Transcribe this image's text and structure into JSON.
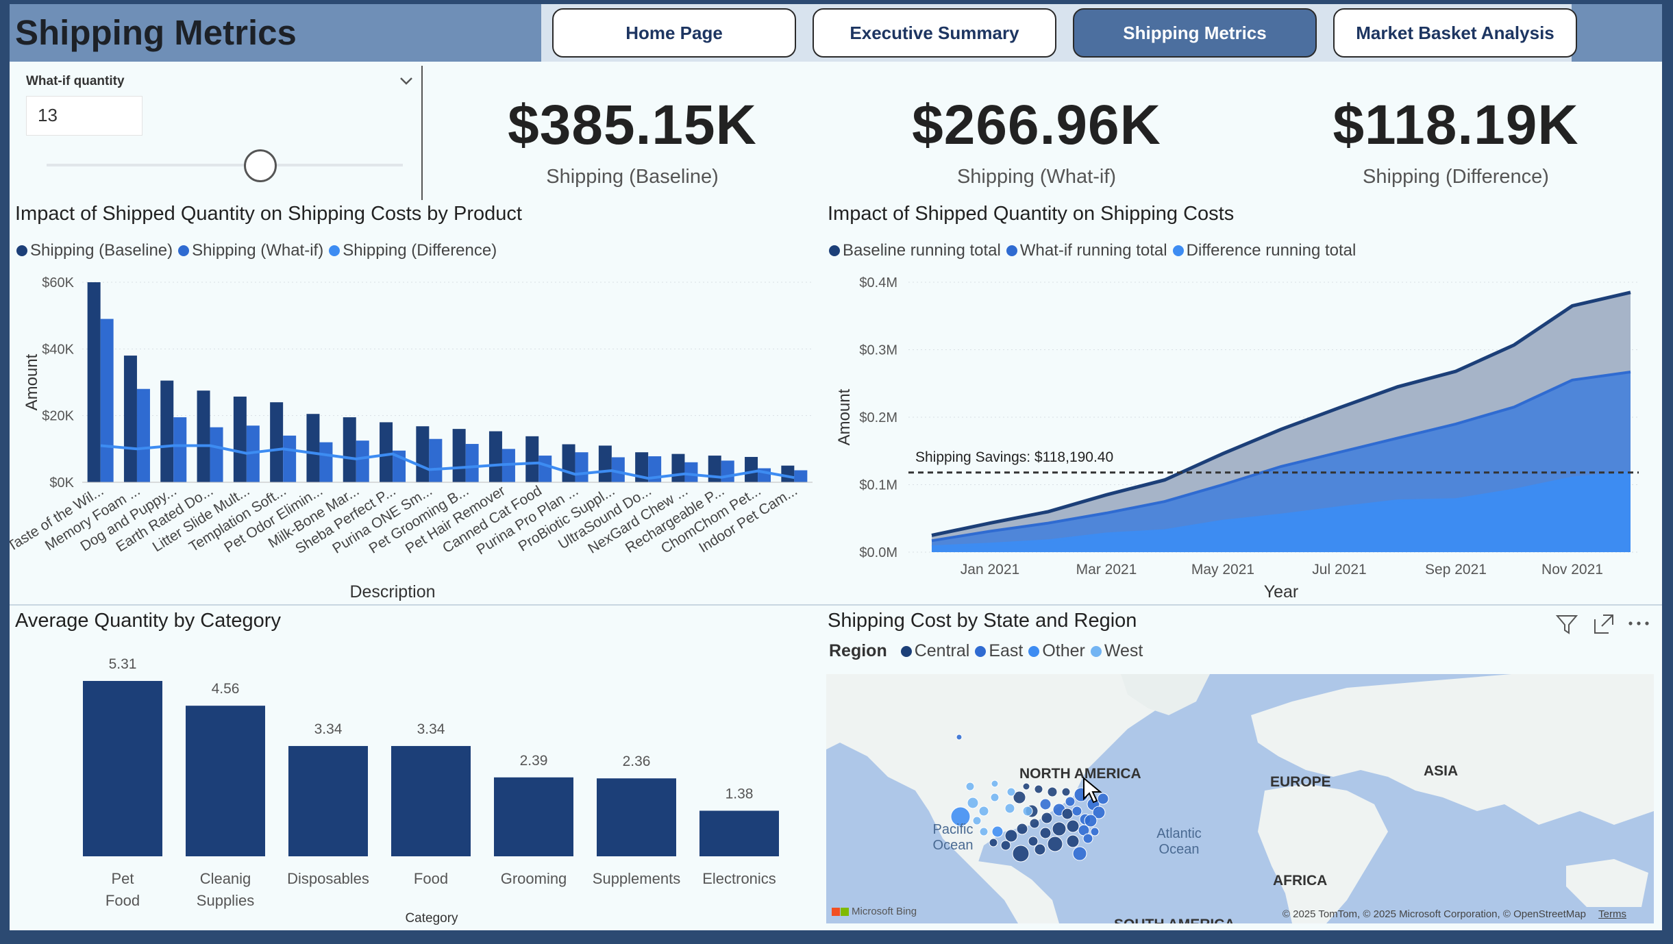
{
  "page": {
    "title": "Shipping Metrics"
  },
  "nav": [
    {
      "label": "Home Page",
      "active": false
    },
    {
      "label": "Executive Summary",
      "active": false
    },
    {
      "label": "Shipping Metrics",
      "active": true
    },
    {
      "label": "Market Basket Analysis",
      "active": false
    }
  ],
  "slicer": {
    "label": "What-if quantity",
    "value": "13",
    "chevron_icon": "chevron-down-icon",
    "slider_fraction": 0.6
  },
  "kpis": [
    {
      "value": "$385.15K",
      "label": "Shipping (Baseline)"
    },
    {
      "value": "$266.96K",
      "label": "Shipping (What-if)"
    },
    {
      "value": "$118.19K",
      "label": "Shipping (Difference)"
    }
  ],
  "colors": {
    "dark": "#1c3f78",
    "mid": "#2f6bd1",
    "light": "#3d8cf2",
    "lighter": "#72b4f3"
  },
  "product_chart": {
    "title": "Impact of Shipped Quantity on Shipping Costs by Product",
    "legend": [
      "Shipping (Baseline)",
      "Shipping (What-if)",
      "Shipping (Difference)"
    ]
  },
  "timeline_chart": {
    "title": "Impact of Shipped Quantity on Shipping Costs",
    "legend": [
      "Baseline running total",
      "What-if running total",
      "Difference running total"
    ],
    "annotation": "Shipping Savings: $118,190.40"
  },
  "category_chart": {
    "title": "Average Quantity by Category"
  },
  "map_visual": {
    "title": "Shipping Cost by State and Region",
    "legend_title": "Region",
    "regions": [
      "Central",
      "East",
      "Other",
      "West"
    ],
    "labels": [
      "NORTH AMERICA",
      "EUROPE",
      "ASIA",
      "AFRICA",
      "SOUTH AMERICA",
      "Pacific Ocean",
      "Atlantic Ocean"
    ],
    "attribution": "© 2025 TomTom, © 2025 Microsoft Corporation, © OpenStreetMap",
    "terms": "Terms",
    "brand": "Microsoft Bing",
    "header_icons": [
      "filter-icon",
      "focus-mode-icon",
      "more-options-icon"
    ]
  },
  "chart_data": [
    {
      "type": "bar",
      "title": "Impact of Shipped Quantity on Shipping Costs by Product",
      "xlabel": "Description",
      "ylabel": "Amount",
      "ylim": [
        0,
        60000
      ],
      "yticks": [
        "$0K",
        "$20K",
        "$40K",
        "$60K"
      ],
      "categories": [
        "Taste of the Wil...",
        "Memory Foam ...",
        "Dog and Puppy...",
        "Earth Rated Do...",
        "Litter Slide Mult...",
        "Templation Soft...",
        "Pet Odor Elimin...",
        "Milk-Bone Mar...",
        "Sheba Perfect P...",
        "Purina ONE Sm...",
        "Pet Grooming B...",
        "Pet Hair Remover",
        "Canned Cat Food",
        "Purina Pro Plan ...",
        "ProBiotic Suppl...",
        "UltraSound Do...",
        "NexGard Chew ...",
        "Rechargeable P...",
        "ChomChom Pet...",
        "Indoor Pet Cam..."
      ],
      "series": [
        {
          "name": "Shipping (Baseline)",
          "values": [
            60000,
            38000,
            30500,
            27500,
            25700,
            24000,
            20500,
            19500,
            18000,
            16800,
            16000,
            15300,
            13800,
            11400,
            11000,
            9000,
            8500,
            8000,
            7600,
            5000
          ]
        },
        {
          "name": "Shipping (What-if)",
          "values": [
            49000,
            28000,
            19500,
            16500,
            17000,
            14000,
            12000,
            12500,
            9500,
            13000,
            11500,
            10000,
            8000,
            9000,
            7500,
            7800,
            6000,
            6500,
            4200,
            3600
          ]
        },
        {
          "name": "Shipping (Difference)",
          "values": [
            11000,
            10000,
            11000,
            11000,
            8700,
            10000,
            8500,
            7000,
            8500,
            3800,
            4500,
            5300,
            5800,
            2400,
            3500,
            1200,
            2500,
            1500,
            3400,
            1400
          ]
        }
      ]
    },
    {
      "type": "area",
      "title": "Impact of Shipped Quantity on Shipping Costs",
      "xlabel": "Year",
      "ylabel": "Amount",
      "ylim": [
        0,
        0.4
      ],
      "yunit": "$M",
      "yticks": [
        "$0.0M",
        "$0.1M",
        "$0.2M",
        "$0.3M",
        "$0.4M"
      ],
      "xticks": [
        "Jan 2021",
        "Mar 2021",
        "May 2021",
        "Jul 2021",
        "Sep 2021",
        "Nov 2021"
      ],
      "x": [
        "Dec 2020",
        "Jan 2021",
        "Feb 2021",
        "Mar 2021",
        "Apr 2021",
        "May 2021",
        "Jun 2021",
        "Jul 2021",
        "Aug 2021",
        "Sep 2021",
        "Oct 2021",
        "Nov 2021",
        "Dec 2021"
      ],
      "reference_line": {
        "label": "Shipping Savings: $118,190.40",
        "value": 0.118
      },
      "series": [
        {
          "name": "Baseline running total",
          "values": [
            0.025,
            0.043,
            0.06,
            0.085,
            0.107,
            0.146,
            0.182,
            0.214,
            0.245,
            0.268,
            0.307,
            0.365,
            0.385
          ]
        },
        {
          "name": "What-if running total",
          "values": [
            0.017,
            0.031,
            0.043,
            0.058,
            0.075,
            0.1,
            0.127,
            0.148,
            0.169,
            0.19,
            0.215,
            0.255,
            0.267
          ]
        },
        {
          "name": "Difference running total",
          "values": [
            0.008,
            0.012,
            0.017,
            0.027,
            0.032,
            0.046,
            0.055,
            0.066,
            0.076,
            0.078,
            0.092,
            0.11,
            0.118
          ]
        }
      ]
    },
    {
      "type": "bar",
      "title": "Average Quantity by Category",
      "xlabel": "Category",
      "ylabel": "",
      "categories": [
        "Pet Food",
        "Cleanig Supplies",
        "Disposables",
        "Food",
        "Grooming",
        "Supplements",
        "Electronics"
      ],
      "values": [
        5.31,
        4.56,
        3.34,
        3.34,
        2.39,
        2.36,
        1.38
      ],
      "ylim": [
        0,
        5.31
      ]
    }
  ]
}
